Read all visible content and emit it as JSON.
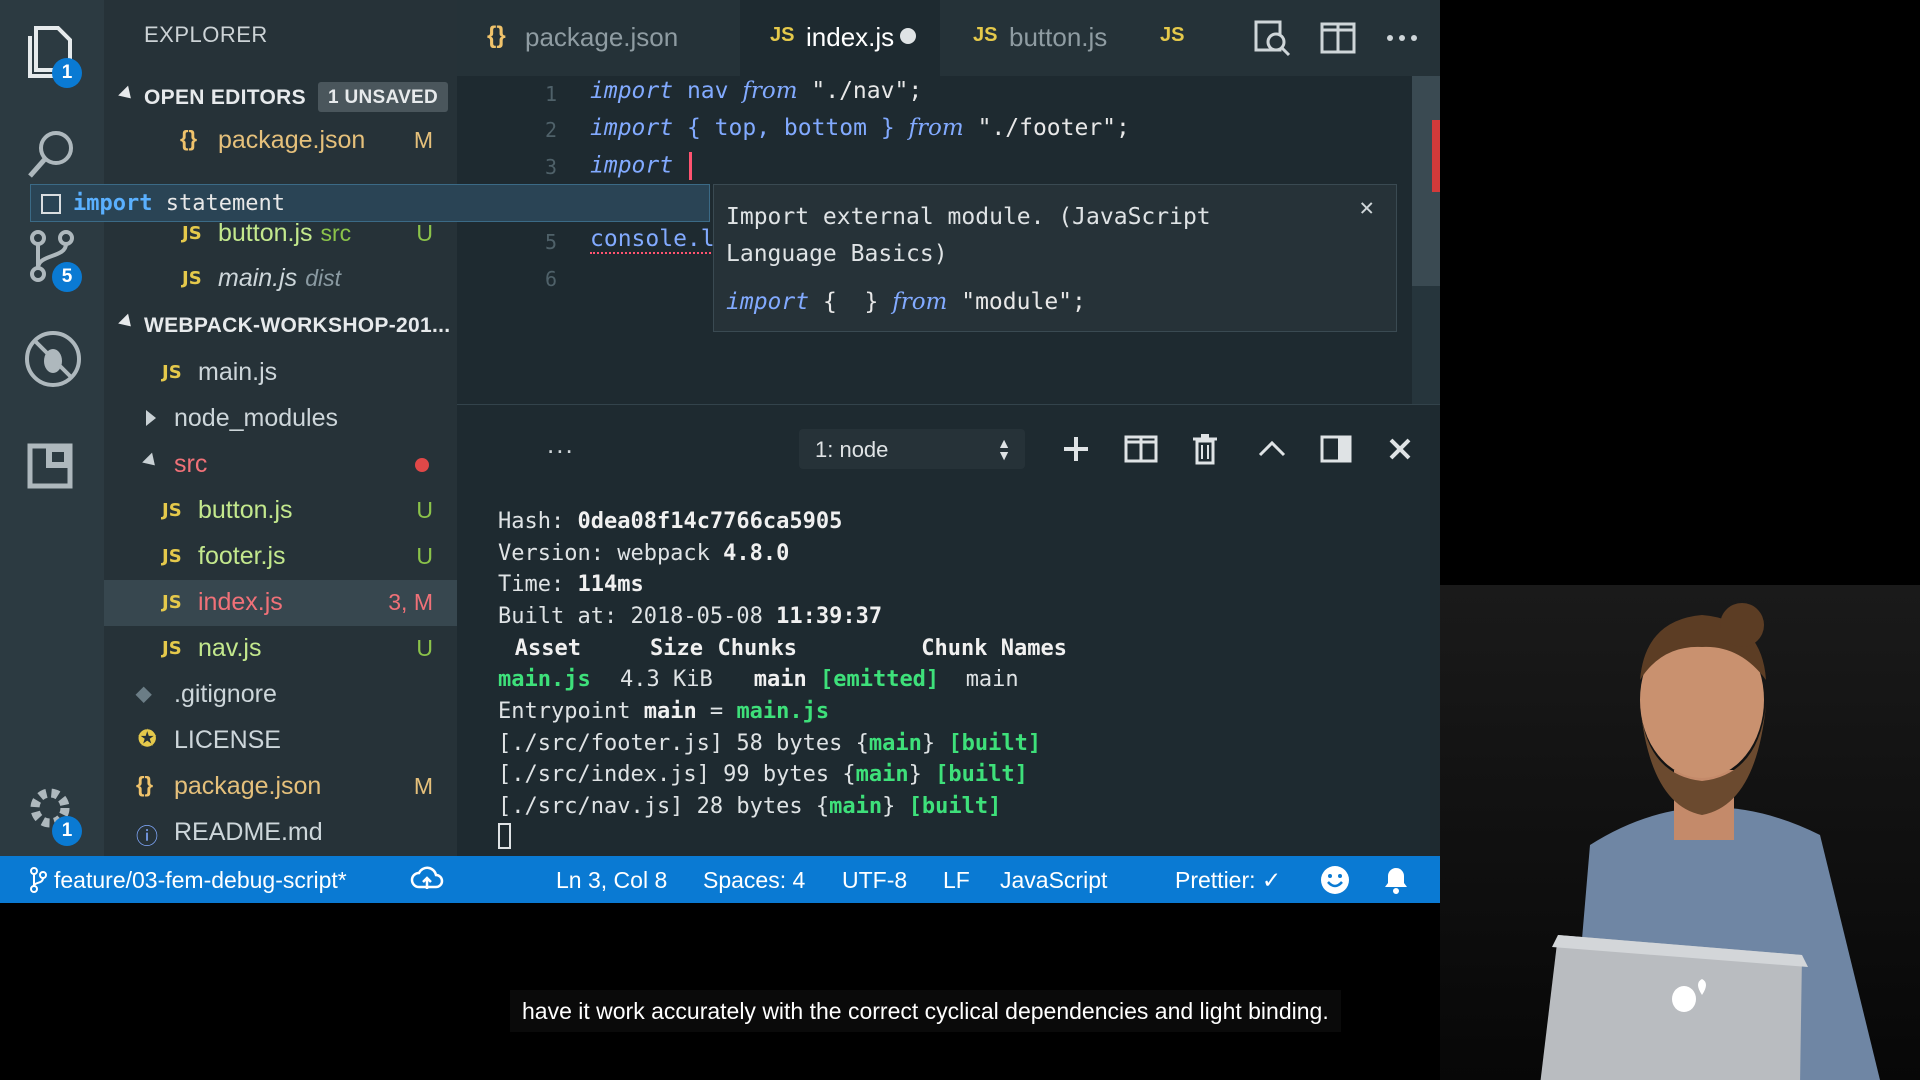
{
  "activity_bar": {
    "explorer_badge": "1",
    "scm_badge": "5",
    "settings_badge": "1"
  },
  "sidebar": {
    "title": "EXPLORER",
    "open_editors": {
      "label": "OPEN EDITORS",
      "unsaved": "1 UNSAVED",
      "items": [
        {
          "icon": "{}",
          "name": "package.json",
          "dir": "",
          "status": "M"
        },
        {
          "icon": "JS",
          "name": "button.js",
          "dir": "src",
          "status": "U"
        },
        {
          "icon": "JS",
          "name": "main.js",
          "dir": "dist",
          "status": ""
        }
      ]
    },
    "workspace": {
      "label": "WEBPACK-WORKSHOP-201...",
      "items": [
        {
          "icon": "JS",
          "name": "main.js",
          "status": ""
        },
        {
          "icon": "",
          "name": "node_modules",
          "status": ""
        },
        {
          "icon": "",
          "name": "src",
          "status": ""
        },
        {
          "icon": "JS",
          "name": "button.js",
          "status": "U"
        },
        {
          "icon": "JS",
          "name": "footer.js",
          "status": "U"
        },
        {
          "icon": "JS",
          "name": "index.js",
          "status": "3, M"
        },
        {
          "icon": "JS",
          "name": "nav.js",
          "status": "U"
        },
        {
          "icon": "",
          "name": ".gitignore",
          "status": ""
        },
        {
          "icon": "",
          "name": "LICENSE",
          "status": ""
        },
        {
          "icon": "{}",
          "name": "package.json",
          "status": "M"
        },
        {
          "icon": "",
          "name": "README.md",
          "status": ""
        }
      ]
    }
  },
  "tabs": [
    {
      "icon": "{}",
      "label": "package.json"
    },
    {
      "icon": "JS",
      "label": "index.js"
    },
    {
      "icon": "JS",
      "label": "button.js"
    },
    {
      "icon": "JS",
      "label": ""
    }
  ],
  "editor": {
    "line_numbers": [
      "1",
      "2",
      "3",
      "5",
      "6"
    ],
    "line1": {
      "kw": "import",
      "id": "nav",
      "from": "from",
      "str": "\"./nav\";"
    },
    "line2": {
      "kw": "import",
      "brace": "{ top, bottom }",
      "from": "from",
      "str": "\"./footer\";"
    },
    "line3": {
      "kw": "import"
    },
    "line5": "console.l"
  },
  "suggest": {
    "keyword": "import",
    "label": "statement"
  },
  "details": {
    "description": "Import external module. (JavaScript Language Basics)",
    "snippet_kw": "import",
    "snippet_braces": "{  }",
    "snippet_from": "from",
    "snippet_str": "\"module\";"
  },
  "panel": {
    "more": "...",
    "terminal_select": "1: node",
    "lines": {
      "hash_label": "Hash: ",
      "hash": "0dea08f14c7766ca5905",
      "version_label": "Version: webpack ",
      "version": "4.8.0",
      "time_label": "Time: ",
      "time": "114ms",
      "built_label": "Built at: 2018-05-08 ",
      "built_time": "11:39:37",
      "h_asset": "Asset",
      "h_size": "Size",
      "h_chunks": "Chunks",
      "h_names": "Chunk Names",
      "a_name": "main.js",
      "a_size": "4.3 KiB",
      "a_chunk": "main",
      "a_emitted": "[emitted]",
      "a_cname": "main",
      "entry_label": "Entrypoint ",
      "entry_main": "main",
      "entry_eq": " = ",
      "entry_file": "main.js",
      "m1_path": "[./src/footer.js]",
      "m1_size": " 58 bytes {",
      "m2_path": "[./src/index.js]",
      "m2_size": " 99 bytes {",
      "m3_path": "[./src/nav.js]",
      "m3_size": " 28 bytes {",
      "m_chunk": "main",
      "m_close": "} ",
      "m_built": "[built]"
    }
  },
  "status_bar": {
    "branch": "feature/03-fem-debug-script*",
    "position": "Ln 3, Col 8",
    "spaces": "Spaces: 4",
    "encoding": "UTF-8",
    "eol": "LF",
    "language": "JavaScript",
    "prettier": "Prettier: ✓"
  },
  "caption": "have it work accurately with the correct cyclical dependencies and light binding."
}
